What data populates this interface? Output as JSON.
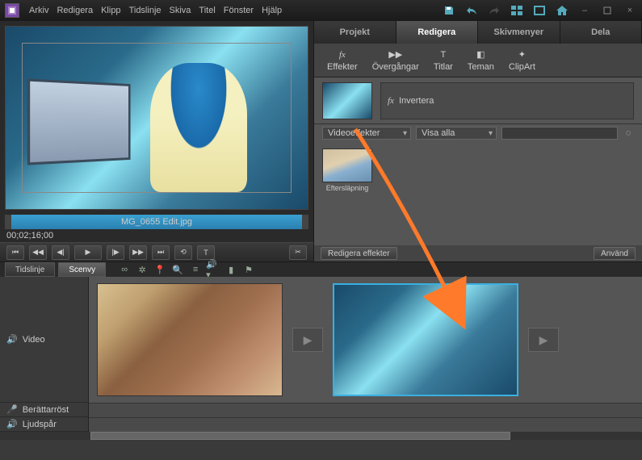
{
  "menu": {
    "items": [
      "Arkiv",
      "Redigera",
      "Klipp",
      "Tidslinje",
      "Skiva",
      "Titel",
      "Fönster",
      "Hjälp"
    ]
  },
  "topIcons": [
    "save-icon",
    "undo-icon",
    "redo-icon",
    "layout-icon",
    "fullscreen-icon",
    "home-icon",
    "minimize-icon",
    "maximize-icon",
    "close-icon"
  ],
  "tabs": {
    "items": [
      "Projekt",
      "Redigera",
      "Skivmenyer",
      "Dela"
    ],
    "active": 1
  },
  "subtabs": {
    "items": [
      {
        "icon": "fx",
        "label": "Effekter"
      },
      {
        "icon": "▶▶",
        "label": "Övergångar"
      },
      {
        "icon": "T",
        "label": "Titlar"
      },
      {
        "icon": "◧",
        "label": "Teman"
      },
      {
        "icon": "✦",
        "label": "ClipArt"
      }
    ],
    "active": 0
  },
  "appliedEffect": {
    "icon": "fx",
    "name": "Invertera"
  },
  "filters": {
    "category": "Videoeffekter",
    "show": "Visa alla"
  },
  "fxItems": [
    {
      "name": "Eftersläpning"
    }
  ],
  "fxFooter": {
    "edit": "Redigera effekter",
    "apply": "Använd"
  },
  "timecode": "00;02;16;00",
  "clipName": "MG_0655 Edit.jpg",
  "bottomTabs": {
    "items": [
      "Tidslinje",
      "Scenvy"
    ],
    "active": 1
  },
  "tracks": {
    "video": "Video",
    "narration": "Berättarröst",
    "audio": "Ljudspår"
  },
  "controls": [
    "⏮",
    "◀◀",
    "◀|",
    "▶",
    "|▶",
    "▶▶",
    "⏭",
    "⟲",
    "T",
    "✂"
  ]
}
